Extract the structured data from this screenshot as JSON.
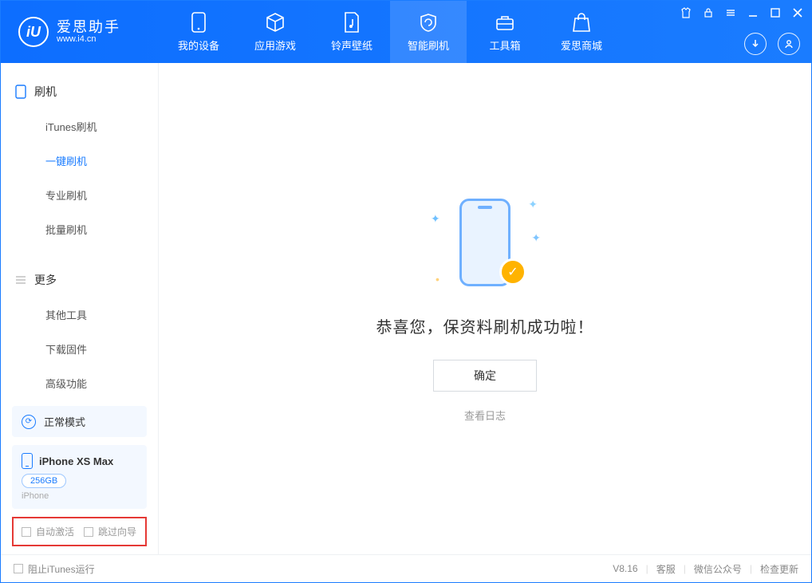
{
  "app": {
    "name_cn": "爱思助手",
    "name_en": "www.i4.cn",
    "logo_letter": "iU"
  },
  "nav": [
    {
      "label": "我的设备"
    },
    {
      "label": "应用游戏"
    },
    {
      "label": "铃声壁纸"
    },
    {
      "label": "智能刷机"
    },
    {
      "label": "工具箱"
    },
    {
      "label": "爱思商城"
    }
  ],
  "sidebar": {
    "section1_title": "刷机",
    "items1": [
      "iTunes刷机",
      "一键刷机",
      "专业刷机",
      "批量刷机"
    ],
    "section2_title": "更多",
    "items2": [
      "其他工具",
      "下载固件",
      "高级功能"
    ]
  },
  "mode": {
    "label": "正常模式"
  },
  "device": {
    "name": "iPhone XS Max",
    "storage": "256GB",
    "type": "iPhone"
  },
  "checks": {
    "auto_activate": "自动激活",
    "skip_guide": "跳过向导"
  },
  "main": {
    "success": "恭喜您，保资料刷机成功啦！",
    "ok": "确定",
    "view_log": "查看日志"
  },
  "footer": {
    "block_itunes": "阻止iTunes运行",
    "version": "V8.16",
    "customer_service": "客服",
    "wechat": "微信公众号",
    "check_update": "检查更新"
  }
}
